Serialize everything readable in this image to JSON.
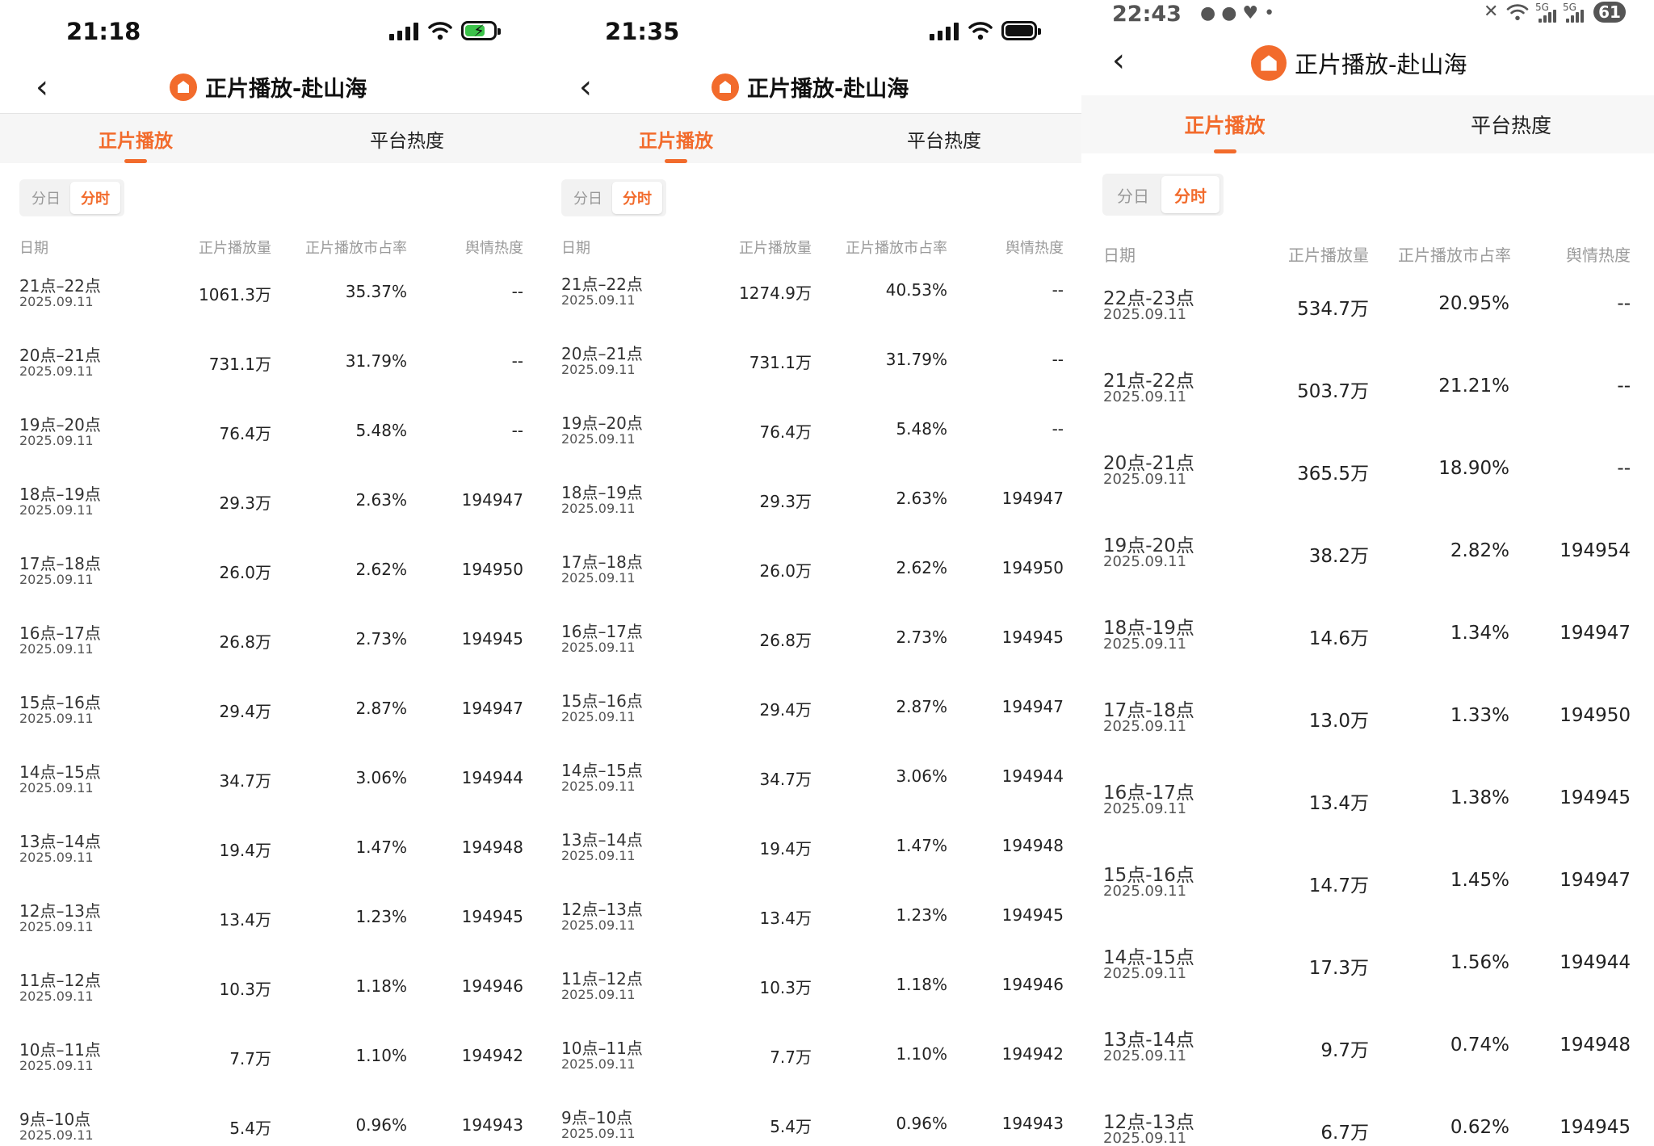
{
  "panels": [
    {
      "status": {
        "time": "21:18",
        "battery_charging": true
      },
      "header": {
        "title": "正片播放-赴山海"
      },
      "tabs": [
        {
          "label": "正片播放"
        },
        {
          "label": "平台热度"
        }
      ],
      "segment": [
        {
          "label": "分日"
        },
        {
          "label": "分时"
        }
      ],
      "columns": [
        "日期",
        "正片播放量",
        "正片播放市占率",
        "舆情热度"
      ],
      "rows": [
        {
          "period": "21点–22点",
          "date": "2025.09.11",
          "views": "1061.3万",
          "share": "35.37%",
          "heat": "--"
        },
        {
          "period": "20点–21点",
          "date": "2025.09.11",
          "views": "731.1万",
          "share": "31.79%",
          "heat": "--"
        },
        {
          "period": "19点–20点",
          "date": "2025.09.11",
          "views": "76.4万",
          "share": "5.48%",
          "heat": "--"
        },
        {
          "period": "18点–19点",
          "date": "2025.09.11",
          "views": "29.3万",
          "share": "2.63%",
          "heat": "194947"
        },
        {
          "period": "17点–18点",
          "date": "2025.09.11",
          "views": "26.0万",
          "share": "2.62%",
          "heat": "194950"
        },
        {
          "period": "16点–17点",
          "date": "2025.09.11",
          "views": "26.8万",
          "share": "2.73%",
          "heat": "194945"
        },
        {
          "period": "15点–16点",
          "date": "2025.09.11",
          "views": "29.4万",
          "share": "2.87%",
          "heat": "194947"
        },
        {
          "period": "14点–15点",
          "date": "2025.09.11",
          "views": "34.7万",
          "share": "3.06%",
          "heat": "194944"
        },
        {
          "period": "13点–14点",
          "date": "2025.09.11",
          "views": "19.4万",
          "share": "1.47%",
          "heat": "194948"
        },
        {
          "period": "12点–13点",
          "date": "2025.09.11",
          "views": "13.4万",
          "share": "1.23%",
          "heat": "194945"
        },
        {
          "period": "11点–12点",
          "date": "2025.09.11",
          "views": "10.3万",
          "share": "1.18%",
          "heat": "194946"
        },
        {
          "period": "10点–11点",
          "date": "2025.09.11",
          "views": "7.7万",
          "share": "1.10%",
          "heat": "194942"
        },
        {
          "period": "9点–10点",
          "date": "2025.09.11",
          "views": "5.4万",
          "share": "0.96%",
          "heat": "194943"
        }
      ]
    },
    {
      "status": {
        "time": "21:35",
        "battery_charging": false
      },
      "header": {
        "title": "正片播放-赴山海"
      },
      "tabs": [
        {
          "label": "正片播放"
        },
        {
          "label": "平台热度"
        }
      ],
      "segment": [
        {
          "label": "分日"
        },
        {
          "label": "分时"
        }
      ],
      "columns": [
        "日期",
        "正片播放量",
        "正片播放市占率",
        "舆情热度"
      ],
      "rows": [
        {
          "period": "21点–22点",
          "date": "2025.09.11",
          "views": "1274.9万",
          "share": "40.53%",
          "heat": "--"
        },
        {
          "period": "20点–21点",
          "date": "2025.09.11",
          "views": "731.1万",
          "share": "31.79%",
          "heat": "--"
        },
        {
          "period": "19点–20点",
          "date": "2025.09.11",
          "views": "76.4万",
          "share": "5.48%",
          "heat": "--"
        },
        {
          "period": "18点–19点",
          "date": "2025.09.11",
          "views": "29.3万",
          "share": "2.63%",
          "heat": "194947"
        },
        {
          "period": "17点–18点",
          "date": "2025.09.11",
          "views": "26.0万",
          "share": "2.62%",
          "heat": "194950"
        },
        {
          "period": "16点–17点",
          "date": "2025.09.11",
          "views": "26.8万",
          "share": "2.73%",
          "heat": "194945"
        },
        {
          "period": "15点–16点",
          "date": "2025.09.11",
          "views": "29.4万",
          "share": "2.87%",
          "heat": "194947"
        },
        {
          "period": "14点–15点",
          "date": "2025.09.11",
          "views": "34.7万",
          "share": "3.06%",
          "heat": "194944"
        },
        {
          "period": "13点–14点",
          "date": "2025.09.11",
          "views": "19.4万",
          "share": "1.47%",
          "heat": "194948"
        },
        {
          "period": "12点–13点",
          "date": "2025.09.11",
          "views": "13.4万",
          "share": "1.23%",
          "heat": "194945"
        },
        {
          "period": "11点–12点",
          "date": "2025.09.11",
          "views": "10.3万",
          "share": "1.18%",
          "heat": "194946"
        },
        {
          "period": "10点–11点",
          "date": "2025.09.11",
          "views": "7.7万",
          "share": "1.10%",
          "heat": "194942"
        },
        {
          "period": "9点–10点",
          "date": "2025.09.11",
          "views": "5.4万",
          "share": "0.96%",
          "heat": "194943"
        }
      ]
    },
    {
      "status": {
        "time": "22:43",
        "battery": "61",
        "signal_label": "5G"
      },
      "header": {
        "title": "正片播放-赴山海"
      },
      "tabs": [
        {
          "label": "正片播放"
        },
        {
          "label": "平台热度"
        }
      ],
      "segment": [
        {
          "label": "分日"
        },
        {
          "label": "分时"
        }
      ],
      "columns": [
        "日期",
        "正片播放量",
        "正片播放市占率",
        "舆情热度"
      ],
      "rows": [
        {
          "period": "22点-23点",
          "date": "2025.09.11",
          "views": "534.7万",
          "share": "20.95%",
          "heat": "--"
        },
        {
          "period": "21点-22点",
          "date": "2025.09.11",
          "views": "503.7万",
          "share": "21.21%",
          "heat": "--"
        },
        {
          "period": "20点-21点",
          "date": "2025.09.11",
          "views": "365.5万",
          "share": "18.90%",
          "heat": "--"
        },
        {
          "period": "19点-20点",
          "date": "2025.09.11",
          "views": "38.2万",
          "share": "2.82%",
          "heat": "194954"
        },
        {
          "period": "18点-19点",
          "date": "2025.09.11",
          "views": "14.6万",
          "share": "1.34%",
          "heat": "194947"
        },
        {
          "period": "17点-18点",
          "date": "2025.09.11",
          "views": "13.0万",
          "share": "1.33%",
          "heat": "194950"
        },
        {
          "period": "16点-17点",
          "date": "2025.09.11",
          "views": "13.4万",
          "share": "1.38%",
          "heat": "194945"
        },
        {
          "period": "15点-16点",
          "date": "2025.09.11",
          "views": "14.7万",
          "share": "1.45%",
          "heat": "194947"
        },
        {
          "period": "14点-15点",
          "date": "2025.09.11",
          "views": "17.3万",
          "share": "1.56%",
          "heat": "194944"
        },
        {
          "period": "13点-14点",
          "date": "2025.09.11",
          "views": "9.7万",
          "share": "0.74%",
          "heat": "194948"
        },
        {
          "period": "12点-13点",
          "date": "2025.09.11",
          "views": "6.7万",
          "share": "0.62%",
          "heat": "194945"
        }
      ]
    }
  ],
  "colors": {
    "accent": "#f26b2c",
    "muted": "#9a9a9a",
    "tab_bg": "#f6f6f6"
  },
  "icons": {
    "back": "chevron-left-icon",
    "logo": "app-logo-icon",
    "wifi": "wifi-icon",
    "signal": "cellular-signal-icon",
    "battery": "battery-icon"
  }
}
